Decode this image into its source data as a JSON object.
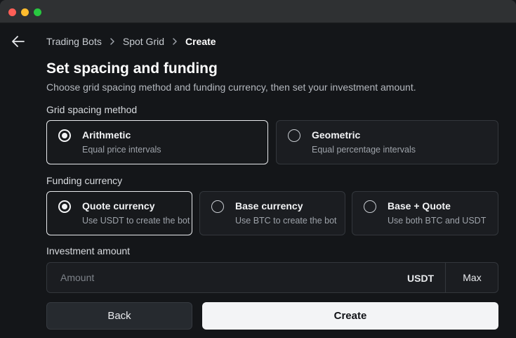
{
  "breadcrumb": {
    "items": [
      "Trading Bots",
      "Spot Grid"
    ],
    "current": "Create"
  },
  "page": {
    "title": "Set spacing and funding",
    "subtitle": "Choose grid spacing method and funding currency, then set your investment amount."
  },
  "grid_spacing": {
    "label": "Grid spacing method",
    "options": [
      {
        "title": "Arithmetic",
        "desc": "Equal price intervals",
        "selected": true
      },
      {
        "title": "Geometric",
        "desc": "Equal percentage intervals",
        "selected": false
      }
    ]
  },
  "funding": {
    "label": "Funding currency",
    "options": [
      {
        "title": "Quote currency",
        "desc": "Use USDT to create the bot",
        "selected": true
      },
      {
        "title": "Base currency",
        "desc": "Use BTC to create the bot",
        "selected": false
      },
      {
        "title": "Base + Quote",
        "desc": "Use both BTC and USDT",
        "selected": false
      }
    ]
  },
  "investment": {
    "label": "Investment amount",
    "placeholder": "Amount",
    "value": "",
    "unit": "USDT",
    "max_label": "Max"
  },
  "actions": {
    "back_label": "Back",
    "create_label": "Create"
  },
  "icons": {
    "back": "arrow-left-icon",
    "separator": "chevron-right-icon"
  }
}
